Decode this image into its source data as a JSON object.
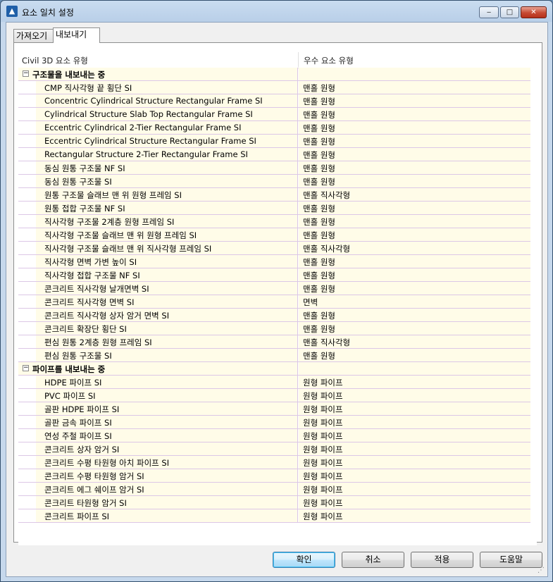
{
  "window": {
    "title": "요소 일치 설정"
  },
  "title_buttons": {
    "minimize": "‒",
    "maximize": "□",
    "close": "✕"
  },
  "tabs": [
    {
      "label": "가져오기"
    },
    {
      "label": "내보내기"
    }
  ],
  "table": {
    "columns": [
      "Civil 3D 요소 유형",
      "우수 요소 유형"
    ],
    "groups": [
      {
        "label": "구조물을 내보내는 중",
        "expander": "−",
        "rows": [
          {
            "name": "CMP 직사각형 끝 횡단 SI",
            "value": "맨홀 원형"
          },
          {
            "name": "Concentric Cylindrical Structure Rectangular Frame SI",
            "value": "맨홀 원형"
          },
          {
            "name": "Cylindrical Structure Slab Top Rectangular Frame SI",
            "value": "맨홀 원형"
          },
          {
            "name": "Eccentric Cylindrical 2-Tier Rectangular Frame SI",
            "value": "맨홀 원형"
          },
          {
            "name": "Eccentric Cylindrical Structure Rectangular Frame SI",
            "value": "맨홀 원형"
          },
          {
            "name": "Rectangular Structure 2-Tier Rectangular Frame SI",
            "value": "맨홀 원형"
          },
          {
            "name": "동심 원통 구조물 NF SI",
            "value": "맨홀 원형"
          },
          {
            "name": "동심 원통 구조물 SI",
            "value": "맨홀 원형"
          },
          {
            "name": "원통 구조물 슬래브 맨 위 원형 프레임 SI",
            "value": "맨홀 직사각형"
          },
          {
            "name": "원통 접합 구조물 NF SI",
            "value": "맨홀 원형"
          },
          {
            "name": "직사각형 구조물 2계층 원형 프레임 SI",
            "value": "맨홀 원형"
          },
          {
            "name": "직사각형 구조물 슬래브 맨 위 원형 프레임 SI",
            "value": "맨홀 원형"
          },
          {
            "name": "직사각형 구조물 슬래브 맨 위 직사각형 프레임 SI",
            "value": "맨홀 직사각형"
          },
          {
            "name": "직사각형 면벽 가변 높이 SI",
            "value": "맨홀 원형"
          },
          {
            "name": "직사각형 접합 구조물 NF SI",
            "value": "맨홀 원형"
          },
          {
            "name": "콘크리트 직사각형 날개면벽 SI",
            "value": "맨홀 원형"
          },
          {
            "name": "콘크리트 직사각형 면벽 SI",
            "value": "면벽"
          },
          {
            "name": "콘크리트 직사각형 상자 암거 면벽 SI",
            "value": "맨홀 원형"
          },
          {
            "name": "콘크리트 확장단 횡단 SI",
            "value": "맨홀 원형"
          },
          {
            "name": "편심 원통 2계층 원형 프레임 SI",
            "value": "맨홀 직사각형"
          },
          {
            "name": "편심 원통 구조물 SI",
            "value": "맨홀 원형"
          }
        ]
      },
      {
        "label": "파이프를 내보내는 중",
        "expander": "−",
        "rows": [
          {
            "name": "HDPE 파이프 SI",
            "value": "원형 파이프"
          },
          {
            "name": "PVC 파이프 SI",
            "value": "원형 파이프"
          },
          {
            "name": "골판 HDPE 파이프 SI",
            "value": "원형 파이프"
          },
          {
            "name": "골판 금속 파이프 SI",
            "value": "원형 파이프"
          },
          {
            "name": "연성 주철 파이프 SI",
            "value": "원형 파이프"
          },
          {
            "name": "콘크리트 상자 암거 SI",
            "value": "원형 파이프"
          },
          {
            "name": "콘크리트 수평 타원형 아치 파이프 SI",
            "value": "원형 파이프"
          },
          {
            "name": "콘크리트 수평 타원형 암거 SI",
            "value": "원형 파이프"
          },
          {
            "name": "콘크리트 에그 쉐이프 암거 SI",
            "value": "원형 파이프"
          },
          {
            "name": "콘크리트 타원형 암거 SI",
            "value": "원형 파이프"
          },
          {
            "name": "콘크리트 파이프 SI",
            "value": "원형 파이프"
          }
        ]
      }
    ]
  },
  "buttons": {
    "ok": "확인",
    "cancel": "취소",
    "apply": "적용",
    "help": "도움말"
  },
  "colors": {
    "row_bg": "#fffce8",
    "row_line": "#dcc7e6",
    "title_bg": "#b9cfe8"
  },
  "icons": {
    "app": "civil3d-app-icon"
  }
}
